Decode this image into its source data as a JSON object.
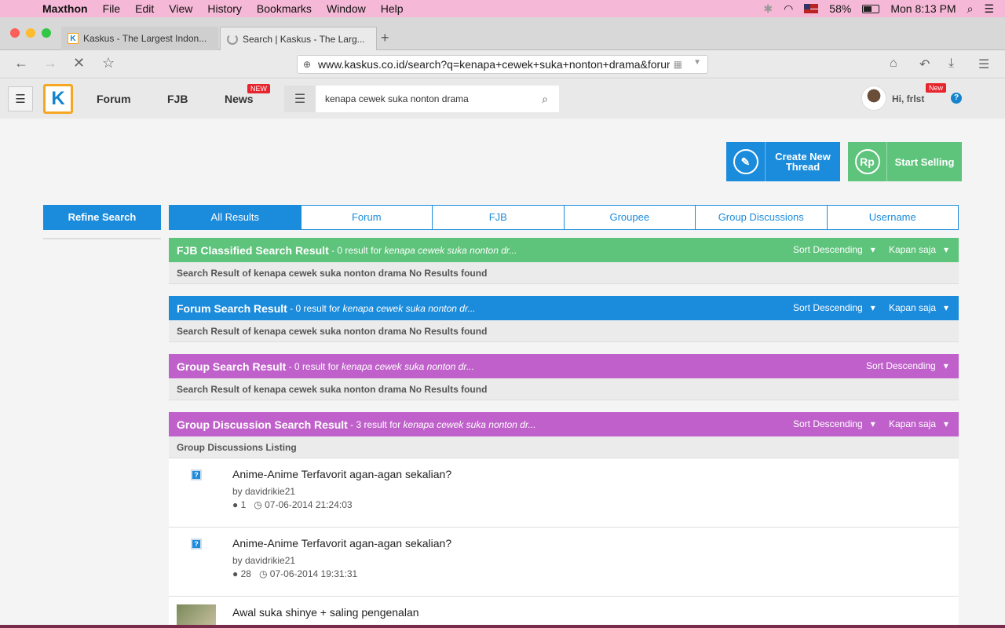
{
  "menubar": {
    "app": "Maxthon",
    "items": [
      "File",
      "Edit",
      "View",
      "History",
      "Bookmarks",
      "Window",
      "Help"
    ],
    "battery": "58%",
    "clock": "Mon 8:13 PM"
  },
  "browser": {
    "tabs": [
      {
        "title": "Kaskus - The Largest Indon..."
      },
      {
        "title": "Search | Kaskus - The Larg..."
      }
    ],
    "new_tab": "+",
    "url": "www.kaskus.co.id/search?q=kenapa+cewek+suka+nonton+drama&forur"
  },
  "header": {
    "logo": "K",
    "nav": [
      "Forum",
      "FJB",
      "News"
    ],
    "news_badge": "NEW",
    "search_value": "kenapa cewek suka nonton drama",
    "user_greeting": "Hi, frlst",
    "user_badge": "New",
    "help": "?"
  },
  "actions": {
    "create_line1": "Create New",
    "create_line2": "Thread",
    "sell": "Start Selling",
    "sell_icon": "Rp"
  },
  "refine": "Refine Search",
  "tabs": [
    "All Results",
    "Forum",
    "FJB",
    "Groupee",
    "Group Discussions",
    "Username"
  ],
  "sections": {
    "fjb": {
      "title": "FJB Classified Search Result",
      "count": " - 0 result for ",
      "query": "kenapa cewek suka nonton dr...",
      "sort": "Sort Descending",
      "time": "Kapan saja",
      "body": "Search Result of kenapa cewek suka nonton drama No Results found"
    },
    "forum": {
      "title": "Forum Search Result",
      "count": " - 0 result for ",
      "query": "kenapa cewek suka nonton dr...",
      "sort": "Sort Descending",
      "time": "Kapan saja",
      "body": "Search Result of kenapa cewek suka nonton drama No Results found"
    },
    "group": {
      "title": "Group Search Result",
      "count": " - 0 result for ",
      "query": "kenapa cewek suka nonton dr...",
      "sort": "Sort Descending",
      "body": "Search Result of kenapa cewek suka nonton drama No Results found"
    },
    "discussion": {
      "title": "Group Discussion Search Result",
      "count": " - 3 result for ",
      "query": "kenapa cewek suka nonton dr...",
      "sort": "Sort Descending",
      "time": "Kapan saja",
      "body": "Group Discussions Listing"
    }
  },
  "threads": [
    {
      "title": "Anime-Anime Terfavorit agan-agan sekalian?",
      "by": "by davidrikie21",
      "replies": "1",
      "date": "07-06-2014 21:24:03"
    },
    {
      "title": "Anime-Anime Terfavorit agan-agan sekalian?",
      "by": "by davidrikie21",
      "replies": "28",
      "date": "07-06-2014 19:31:31"
    },
    {
      "title": "Awal suka shinye + saling pengenalan"
    }
  ]
}
